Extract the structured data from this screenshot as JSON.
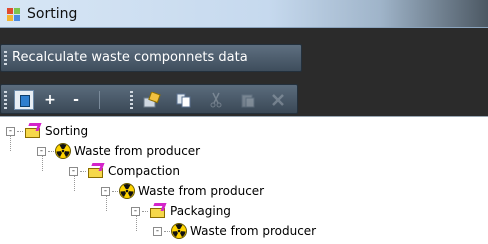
{
  "window": {
    "title": "Sorting"
  },
  "toolbar_top": {
    "recalc_label": "Recalculate waste componnets data"
  },
  "toolbar_icons": {
    "add_label": "+",
    "remove_label": "-"
  },
  "tree": {
    "nodes": [
      {
        "label": "Sorting",
        "icon": "sorting-icon",
        "expander": "-"
      },
      {
        "label": "Waste from producer",
        "icon": "radiation-icon",
        "expander": "-"
      },
      {
        "label": "Compaction",
        "icon": "sorting-icon",
        "expander": "-"
      },
      {
        "label": "Waste from producer",
        "icon": "radiation-icon",
        "expander": "-"
      },
      {
        "label": "Packaging",
        "icon": "sorting-icon",
        "expander": "-"
      },
      {
        "label": "Waste from producer",
        "icon": "radiation-icon",
        "expander": "-"
      }
    ]
  }
}
